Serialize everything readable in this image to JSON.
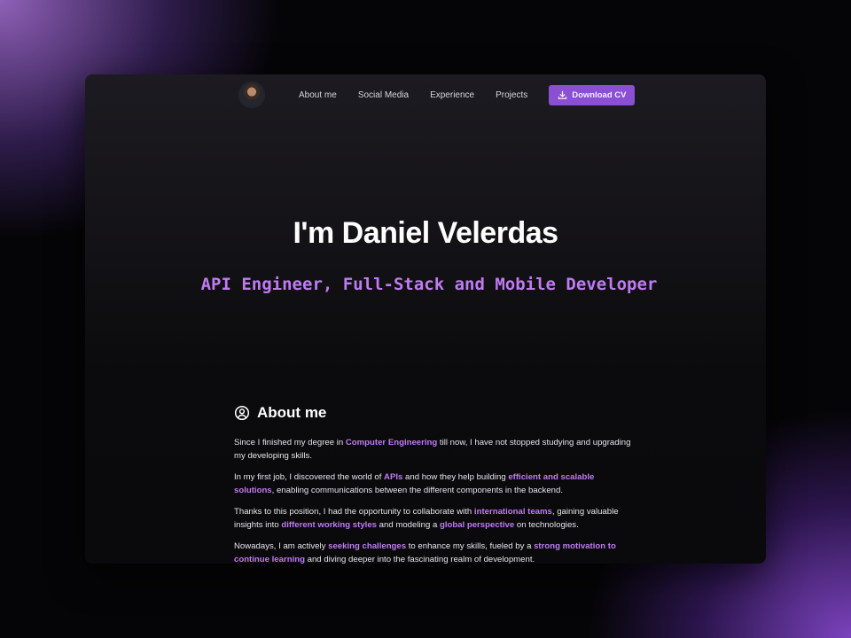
{
  "nav": {
    "avatar_alt": "Daniel Velerdas",
    "links": [
      "About me",
      "Social Media",
      "Experience",
      "Projects"
    ],
    "cv_button": "Download CV",
    "cv_icon": "download-icon"
  },
  "hero": {
    "title": "I'm Daniel Velerdas",
    "subtitle": "API Engineer, Full-Stack and Mobile Developer"
  },
  "about": {
    "heading": "About me",
    "heading_icon": "user-circle-icon",
    "paragraphs": [
      {
        "t1": "Since I finished my degree in ",
        "h1": "Computer Engineering",
        "t2": " till now, I have not stopped studying and upgrading my developing skills."
      },
      {
        "t1": "In my first job, I discovered the world of ",
        "h1": "APIs",
        "t2": " and how they help building ",
        "h2": "efficient and scalable solutions",
        "t3": ", enabling communications between the different components in the backend."
      },
      {
        "t1": "Thanks to this position, I had the opportunity to collaborate with ",
        "h1": "international teams",
        "t2": ", gaining valuable insights into ",
        "h2": "different working styles",
        "t3": " and modeling a ",
        "h3": "global perspective",
        "t4": " on technologies."
      },
      {
        "t1": "Nowadays, I am actively ",
        "h1": "seeking challenges",
        "t2": " to enhance my skills, fueled by a ",
        "h2": "strong motivation to continue learning",
        "t3": " and diving deeper into the fascinating realm of development."
      }
    ]
  },
  "colors": {
    "accent": "#c07bf2",
    "button": "#8b4fd3",
    "background": "#0a0a0c"
  }
}
